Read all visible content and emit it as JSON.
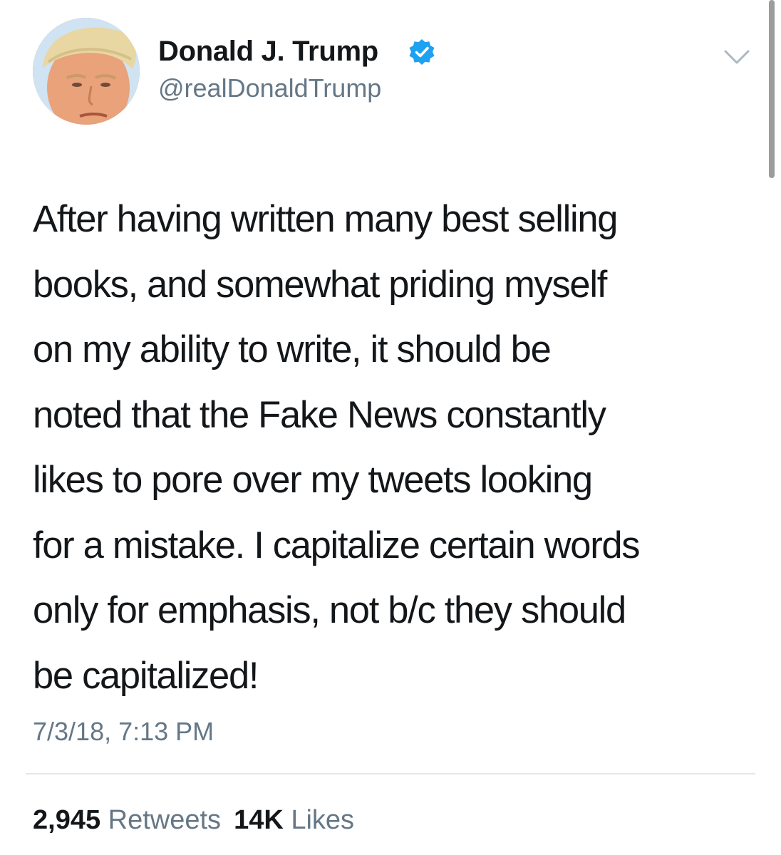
{
  "profile": {
    "display_name": "Donald J. Trump",
    "handle": "@realDonaldTrump",
    "verified_icon": "verified-badge-icon",
    "avatar_icon": "profile-photo",
    "accent_color": "#1da1f2"
  },
  "tweet": {
    "lines": [
      "After having written many best selling",
      "books, and somewhat priding myself",
      "on my ability to write, it should be",
      "noted that the Fake News constantly",
      "likes to pore over my tweets looking",
      "for a mistake. I capitalize certain words",
      "only for emphasis, not b/c they should",
      "be capitalized!"
    ],
    "timestamp": "7/3/18, 7:13 PM"
  },
  "stats": {
    "retweets_count": "2,945",
    "retweets_label": "Retweets",
    "likes_count": "14K",
    "likes_label": "Likes"
  },
  "menu": {
    "icon": "chevron-down-icon"
  }
}
